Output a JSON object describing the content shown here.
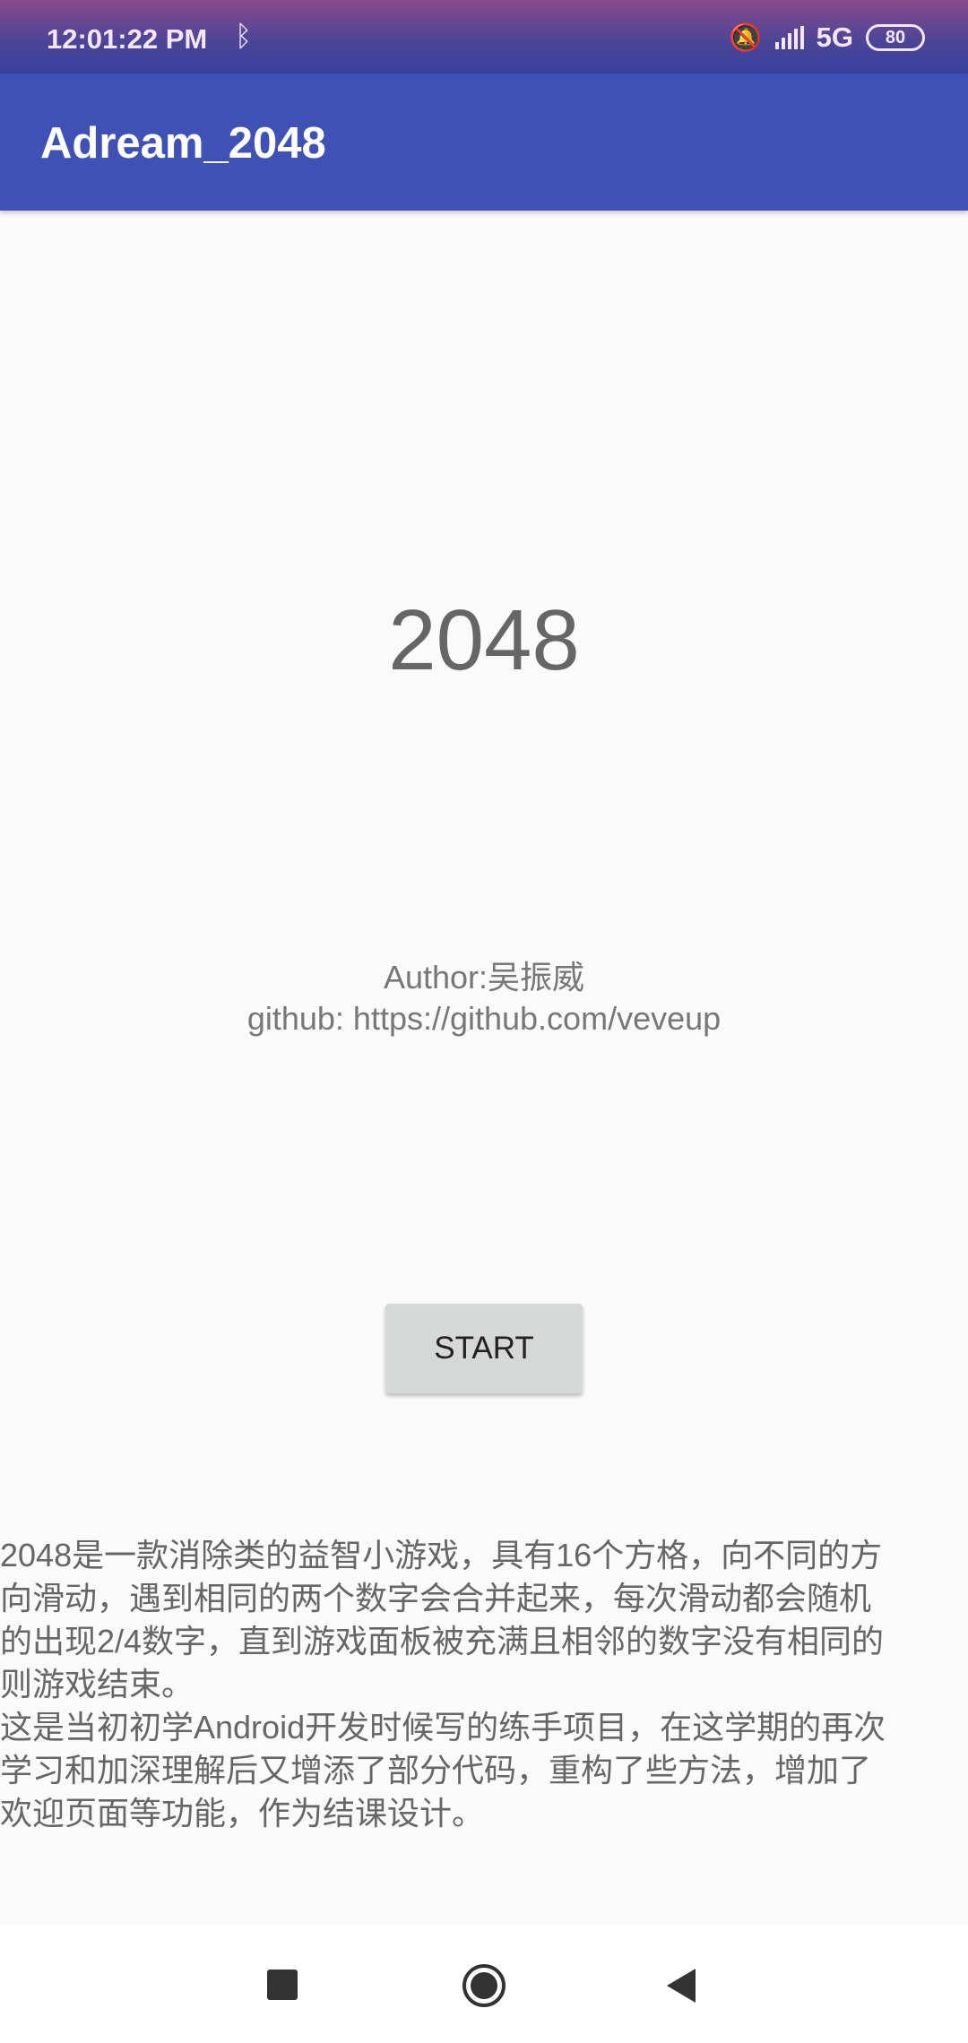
{
  "status_bar": {
    "time": "12:01:22 PM",
    "network": "5G",
    "battery": "80"
  },
  "app_bar": {
    "title": "Adream_2048"
  },
  "main": {
    "heading": "2048",
    "author": "Author:吴振威",
    "github": "github: https://github.com/veveup",
    "start_label": "START",
    "description_lines": [
      "2048是一款消除类的益智小游戏，具有16个方格，向不同的方",
      "向滑动，遇到相同的两个数字会合并起来，每次滑动都会随机",
      "的出现2/4数字，直到游戏面板被充满且相邻的数字没有相同的",
      "则游戏结束。",
      "这是当初初学Android开发时候写的练手项目，在这学期的再次",
      "学习和加深理解后又增添了部分代码，重构了些方法，增加了",
      "欢迎页面等功能，作为结课设计。"
    ]
  },
  "colors": {
    "primary": "#3f51b5",
    "background": "#fafafa",
    "button": "#d6d7d7"
  }
}
